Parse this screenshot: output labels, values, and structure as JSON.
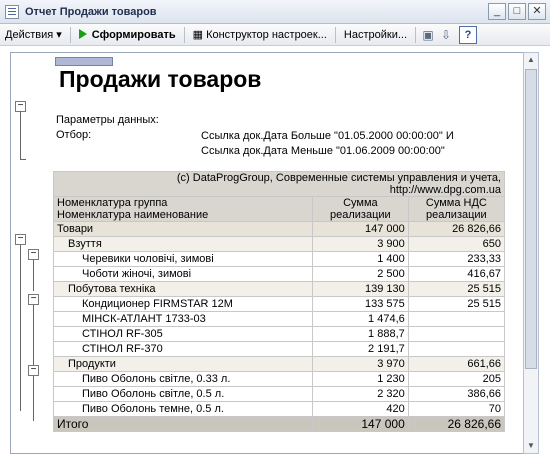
{
  "window": {
    "title": "Отчет  Продажи товаров",
    "minimize": "_",
    "maximize": "□",
    "close": "✕"
  },
  "toolbar": {
    "actions": "Действия",
    "run": "Сформировать",
    "constructor": "Конструктор настроек...",
    "settings": "Настройки...",
    "help": "?"
  },
  "report": {
    "title": "Продажи товаров",
    "params_label": "Параметры данных:",
    "filter_label": "Отбор:",
    "filter_lines": [
      "Ссылка док.Дата Больше \"01.05.2000 00:00:00\" И",
      "Ссылка док.Дата Меньше \"01.06.2009 00:00:00\""
    ],
    "copyright_1": "(c) DataProgGroup, Современные системы управления и учета,",
    "copyright_2": "http://www.dpg.com.ua",
    "headers": {
      "group": "Номенклатура группа",
      "name": "Номенклатура наименование",
      "sum_1": "Сумма",
      "sum_2": "реализации",
      "vat_1": "Сумма НДС",
      "vat_2": "реализации"
    },
    "rows": [
      {
        "name": "Товари",
        "sum": "147 000",
        "vat": "26 826,66"
      },
      {
        "name": "Взуття",
        "sum": "3 900",
        "vat": "650"
      },
      {
        "name": "Черевики чоловічі, зимові",
        "sum": "1 400",
        "vat": "233,33"
      },
      {
        "name": "Чоботи  жіночі, зимові",
        "sum": "2 500",
        "vat": "416,67"
      },
      {
        "name": "Побутова техніка",
        "sum": "139 130",
        "vat": "25 515"
      },
      {
        "name": "Кондиционер FIRMSTAR 12M",
        "sum": "133 575",
        "vat": "25 515"
      },
      {
        "name": "МІНСК-АТЛАНТ 1733-03",
        "sum": "1 474,6",
        "vat": ""
      },
      {
        "name": "СТІНОЛ RF-305",
        "sum": "1 888,7",
        "vat": ""
      },
      {
        "name": "СТІНОЛ RF-370",
        "sum": "2 191,7",
        "vat": ""
      },
      {
        "name": "Продукти",
        "sum": "3 970",
        "vat": "661,66"
      },
      {
        "name": "Пиво Оболонь світле, 0.33 л.",
        "sum": "1 230",
        "vat": "205"
      },
      {
        "name": "Пиво Оболонь світле, 0.5 л.",
        "sum": "2 320",
        "vat": "386,66"
      },
      {
        "name": "Пиво Оболонь темне, 0.5 л.",
        "sum": "420",
        "vat": "70"
      }
    ],
    "total": {
      "label": "Итого",
      "sum": "147 000",
      "vat": "26 826,66"
    }
  }
}
